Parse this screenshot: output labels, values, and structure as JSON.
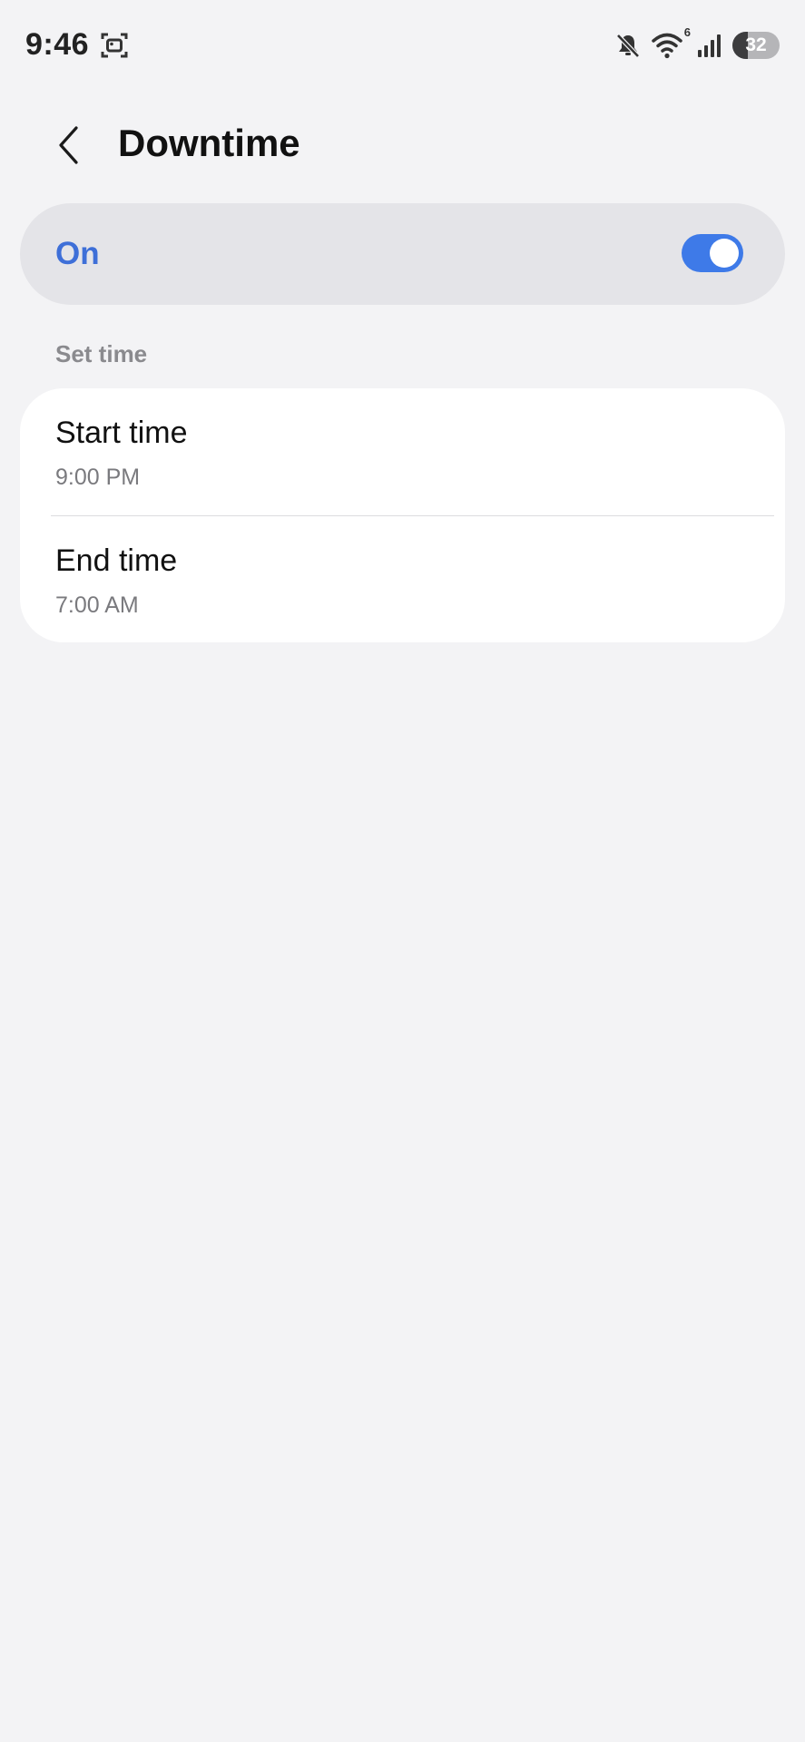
{
  "status_bar": {
    "time": "9:46",
    "wifi_badge": "6",
    "battery_level": "32",
    "battery_fraction": 0.32
  },
  "header": {
    "title": "Downtime",
    "back_icon": "chevron-left-icon"
  },
  "master_switch": {
    "label": "On",
    "state": "on",
    "accent_color": "#3e7ae8",
    "label_color": "#3e6fd8"
  },
  "set_time": {
    "section_label": "Set time",
    "items": [
      {
        "title": "Start time",
        "value": "9:00 PM"
      },
      {
        "title": "End time",
        "value": "7:00 AM"
      }
    ]
  }
}
